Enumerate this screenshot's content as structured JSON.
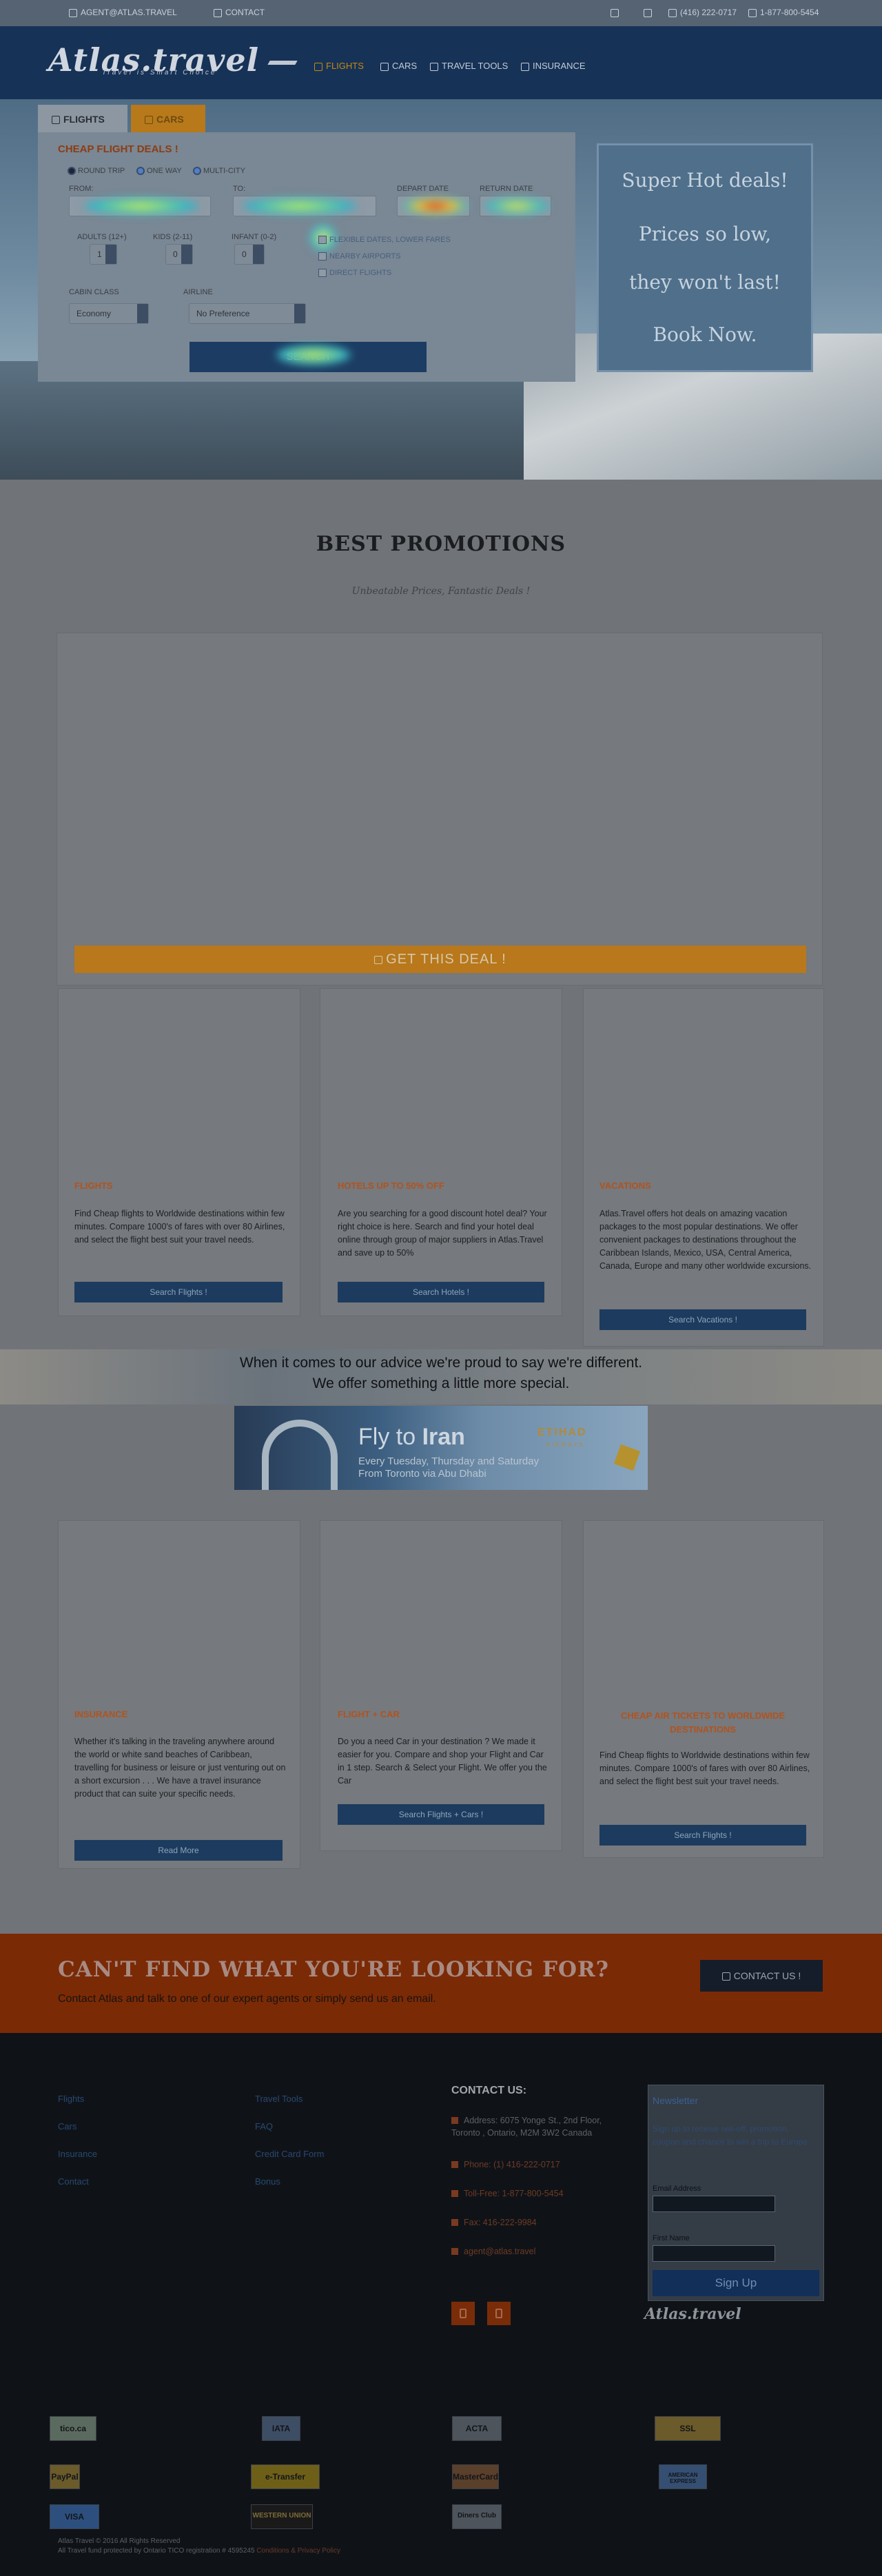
{
  "topbar": {
    "email": "AGENT@ATLAS.TRAVEL",
    "contact": "CONTACT",
    "phone1": "(416) 222-0717",
    "phone2": "1-877-800-5454"
  },
  "header": {
    "logo": "Atlas.travel",
    "tagline": "Travel is Smart Choice",
    "nav": [
      {
        "label": "FLIGHTS",
        "active": true
      },
      {
        "label": "CARS",
        "active": false
      },
      {
        "label": "TRAVEL TOOLS",
        "active": false
      },
      {
        "label": "INSURANCE",
        "active": false
      }
    ]
  },
  "search": {
    "tab_flights": "FLIGHTS",
    "tab_cars": "CARS",
    "heading": "CHEAP FLIGHT DEALS !",
    "trip_types": [
      "ROUND TRIP",
      "ONE WAY",
      "MULTI-CITY"
    ],
    "from_label": "FROM:",
    "to_label": "TO:",
    "depart_label": "DEPART DATE",
    "return_label": "RETURN DATE",
    "adults_label": "ADULTS (12+)",
    "kids_label": "KIDS (2-11)",
    "infant_label": "INFANT (0-2)",
    "adults_value": "1",
    "kids_value": "0",
    "infant_value": "0",
    "options": [
      "FLEXIBLE DATES, LOWER FARES",
      "NEARBY AIRPORTS",
      "DIRECT FLIGHTS"
    ],
    "cabin_label": "CABIN CLASS",
    "cabin_value": "Economy",
    "airline_label": "AIRLINE",
    "airline_value": "No Preference",
    "submit": "SEARCH"
  },
  "hot_deals": {
    "line1": "Super Hot deals!",
    "line2": "Prices so low,",
    "line3": "they won't last!",
    "line4": "Book Now."
  },
  "promotions": {
    "title": "BEST PROMOTIONS",
    "subtitle": "Unbeatable Prices, Fantastic Deals !",
    "deal_button": "GET THIS DEAL !"
  },
  "cards_row1": [
    {
      "title": "FLIGHTS",
      "text": "Find Cheap flights to Worldwide destinations within few minutes. Compare 1000's of fares with over 80 Airlines, and select the flight best suit your travel needs.",
      "button": "Search Flights !"
    },
    {
      "title": "HOTELS UP TO 50% OFF",
      "text": "Are you searching for a good discount hotel deal? Your right choice is here. Search and find your hotel deal online through group of major suppliers in Atlas.Travel and save up to 50%",
      "button": "Search Hotels !"
    },
    {
      "title": "VACATIONS",
      "text": "Atlas.Travel offers hot deals on amazing vacation packages to the most popular destinations. We offer convenient packages to destinations throughout the Caribbean Islands, Mexico, USA, Central America, Canada, Europe and many other worldwide excursions.",
      "button": "Search Vacations !"
    }
  ],
  "band": {
    "line1": "When it comes to our advice we're proud to say we're different.",
    "line2": "We offer something a little more special."
  },
  "ad": {
    "headline_pre": "Fly to ",
    "headline_city": "Iran",
    "sub1": "Every Tuesday, Thursday and Saturday",
    "sub2": "From Toronto via Abu Dhabi",
    "brand": "ETIHAD",
    "brand_sub": "AIRWAYS"
  },
  "cards_row2": [
    {
      "title": "INSURANCE",
      "text": "Whether it's talking in the traveling anywhere around the world or white sand beaches of Caribbean, travelling for business or leisure or just venturing out on a short excursion . . . We have a travel insurance product that can suite your specific needs.",
      "button": "Read More"
    },
    {
      "title": "FLIGHT + CAR",
      "text": "Do you a need Car in your destination ? We made it easier for you. Compare and shop your Flight and Car in 1 step. Search & Select your Flight. We offer you the Car",
      "button": "Search Flights + Cars !"
    },
    {
      "title": "CHEAP AIR TICKETS TO WORLDWIDE DESTINATIONS",
      "text": "Find Cheap flights to Worldwide destinations within few minutes. Compare 1000's of fares with over 80 Airlines, and select the flight best suit your travel needs.",
      "button": "Search Flights !"
    }
  ],
  "cta": {
    "heading": "CAN'T FIND WHAT YOU'RE LOOKING FOR?",
    "sub": "Contact Atlas and talk to one of our expert agents or simply send us an email.",
    "button": "CONTACT US !"
  },
  "footer": {
    "col1": [
      "Flights",
      "Cars",
      "Insurance",
      "Contact"
    ],
    "col2": [
      "Travel Tools",
      "FAQ",
      "Credit Card Form",
      "Bonus"
    ],
    "contact_heading": "CONTACT US:",
    "address": "Address: 6075 Yonge St., 2nd Floor, Toronto , Ontario, M2M 3W2 Canada",
    "phone": "Phone: (1) 416-222-0717",
    "tollfree": "Toll-Free: 1-877-800-5454",
    "fax": "Fax: 416-222-9984",
    "email": "agent@atlas.travel",
    "newsletter_title": "Newsletter",
    "newsletter_desc": "Sign up to receive sell-off, promotion, coupon and chance to win a trip to Europe.",
    "email_label": "Email Address",
    "name_label": "First Name",
    "signup": "Sign Up",
    "logo": "Atlas.travel"
  },
  "badges": [
    "tico.ca",
    "IATA",
    "ACTA",
    "SSL",
    "PayPal",
    "e-Transfer",
    "MasterCard",
    "AMERICAN EXPRESS",
    "VISA",
    "WESTERN UNION",
    "Diners Club"
  ],
  "copyright": {
    "line1": "Atlas Travel © 2016 All Rights Reserved",
    "line2": "All Travel fund protected by Ontario TICO registration # 4595245",
    "terms": "Conditions & Privacy Policy"
  }
}
